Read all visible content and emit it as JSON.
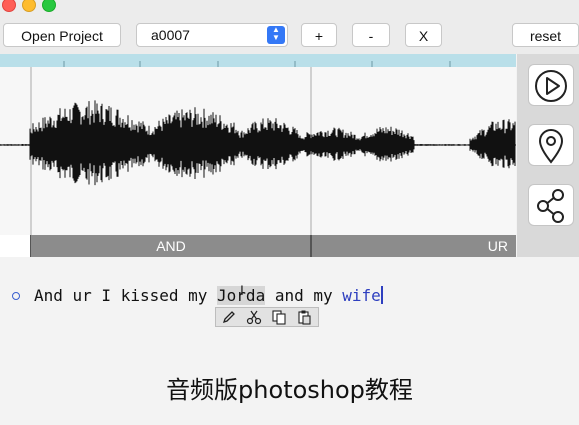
{
  "toolbar": {
    "open_project_label": "Open Project",
    "project_select_value": "a0007",
    "plus_label": "+",
    "minus_label": "-",
    "close_label": "X",
    "reset_label": "reset"
  },
  "segments": {
    "first_label": "AND",
    "second_label": "UR"
  },
  "side_panel": {
    "icons": [
      "play-icon",
      "location-pin-icon",
      "share-icon"
    ]
  },
  "transcript": {
    "before_highlight": "And ur I kissed my ",
    "highlighted_word": "Jorda",
    "between": " and my ",
    "last_word": "wife"
  },
  "mini_toolbar": {
    "icons": [
      "edit-icon",
      "cut-icon",
      "copy-icon",
      "paste-icon"
    ]
  },
  "caption": "音频版photoshop教程",
  "colors": {
    "ruler": "#b9dfe9",
    "segment_bar": "#8c8c8c",
    "accent_blue": "#3478f6",
    "word_blue": "#2e3fbf"
  }
}
